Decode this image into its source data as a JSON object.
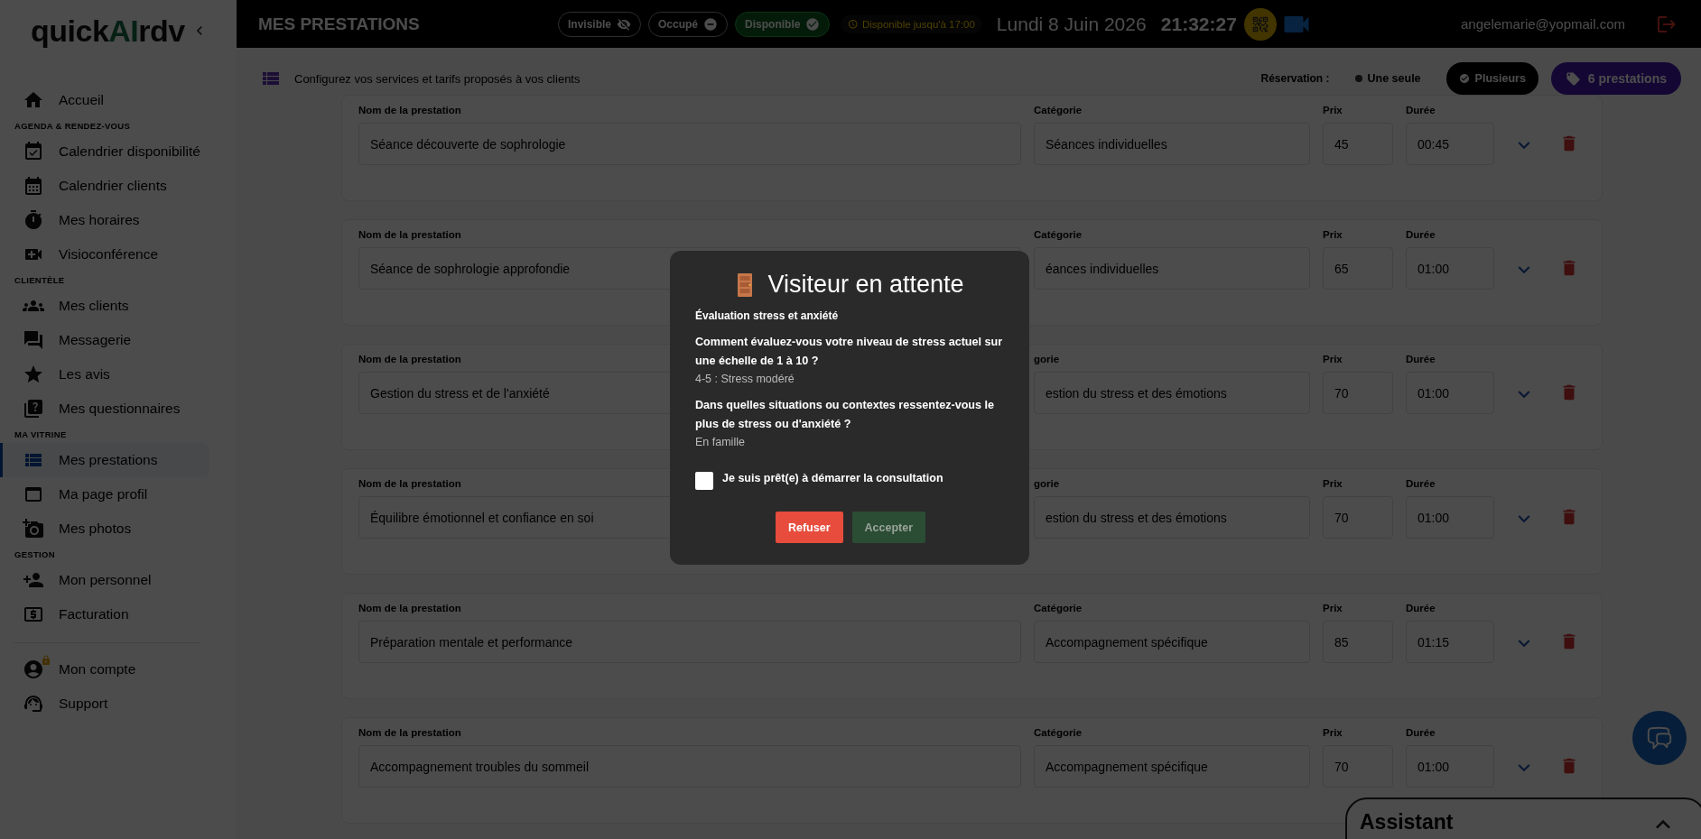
{
  "sidebar": {
    "logo": {
      "prefix": "quick",
      "highlight": "AI",
      "suffix": "rdv"
    },
    "sections": [
      {
        "items": [
          {
            "label": "Accueil",
            "selected": false
          }
        ]
      },
      {
        "heading": "AGENDA & RENDEZ-VOUS",
        "items": [
          {
            "label": "Calendrier disponibilité",
            "selected": false
          },
          {
            "label": "Calendrier clients",
            "selected": false
          },
          {
            "label": "Mes horaires",
            "selected": false
          },
          {
            "label": "Visioconférence",
            "selected": false
          }
        ]
      },
      {
        "heading": "CLIENTÈLE",
        "items": [
          {
            "label": "Mes clients",
            "selected": false
          },
          {
            "label": "Messagerie",
            "selected": false
          },
          {
            "label": "Les avis",
            "selected": false
          },
          {
            "label": "Mes questionnaires",
            "selected": false
          }
        ]
      },
      {
        "heading": "MA VITRINE",
        "items": [
          {
            "label": "Mes prestations",
            "selected": true
          },
          {
            "label": "Ma page profil",
            "selected": false
          },
          {
            "label": "Mes photos",
            "selected": false
          }
        ]
      },
      {
        "heading": "GESTION",
        "items": [
          {
            "label": "Mon personnel",
            "selected": false
          },
          {
            "label": "Facturation",
            "selected": false
          }
        ]
      }
    ],
    "footer_items": [
      {
        "label": "Mon compte",
        "selected": false
      },
      {
        "label": "Support",
        "selected": false
      }
    ]
  },
  "header": {
    "title": "MES PRESTATIONS",
    "statuses": [
      {
        "label": "Invisible",
        "selected": false
      },
      {
        "label": "Occupé",
        "selected": false
      },
      {
        "label": "Disponible",
        "selected": true
      }
    ],
    "availability_note": "Disponible jusqu'à 17:00",
    "date": "Lundi 8 Juin 2026",
    "time": "21:32:27",
    "email": "angelemarie@yopmail.com"
  },
  "subheader": {
    "description": "Configurez vos services et tarifs proposés à vos clients",
    "reservation_label": "Réservation :",
    "reservation_options": [
      {
        "label": "Une seule",
        "selected": false
      },
      {
        "label": "Plusieurs",
        "selected": true
      }
    ],
    "services_count": "6 prestations"
  },
  "services": [
    {
      "labels": [
        "Nom de la prestation",
        "Catégorie",
        "Prix",
        "Durée"
      ],
      "name": "Séance découverte de sophrologie",
      "category": "Séances individuelles",
      "price": "45",
      "duration": "00:45"
    },
    {
      "labels": [
        "Nom de la prestation",
        "Catégorie",
        "Prix",
        "Durée"
      ],
      "name": "Séance de sophrologie approfondie",
      "category": "éances individuelles",
      "price": "65",
      "duration": "01:00"
    },
    {
      "labels": [
        "Nom de la prestation",
        "gorie",
        "Prix",
        "Durée"
      ],
      "name": "Gestion du stress et de l'anxiété",
      "category": "estion du stress et des émotions",
      "price": "70",
      "duration": "01:00"
    },
    {
      "labels": [
        "Nom de la prestation",
        "gorie",
        "Prix",
        "Durée"
      ],
      "name": "Équilibre émotionnel et confiance en soi",
      "category": "estion du stress et des émotions",
      "price": "70",
      "duration": "01:00"
    },
    {
      "labels": [
        "Nom de la prestation",
        "Catégorie",
        "Prix",
        "Durée"
      ],
      "name": "Préparation mentale et performance",
      "category": "Accompagnement spécifique",
      "price": "85",
      "duration": "01:15"
    },
    {
      "labels": [
        "Nom de la prestation",
        "Catégorie",
        "Prix",
        "Durée"
      ],
      "name": "Accompagnement troubles du sommeil",
      "category": "Accompagnement spécifique",
      "price": "70",
      "duration": "01:00"
    }
  ],
  "modal": {
    "title": "Visiteur en attente",
    "subtitle": "Évaluation stress et anxiété",
    "questions": [
      {
        "question": "Comment évaluez-vous votre niveau de stress actuel sur une échelle de 1 à 10 ?",
        "answer": "4-5 : Stress modéré"
      },
      {
        "question": "Dans quelles situations ou contextes ressentez-vous le plus de stress ou d'anxiété ?",
        "answer": "En famille"
      }
    ],
    "checkbox": {
      "label": "Je suis prêt(e) à démarrer la consultation",
      "checked": false
    },
    "buttons": [
      {
        "label": "Refuser",
        "kind": "danger",
        "disabled": false
      },
      {
        "label": "Accepter",
        "kind": "confirm",
        "disabled": true
      }
    ]
  },
  "assistant": {
    "title": "Assistant"
  }
}
